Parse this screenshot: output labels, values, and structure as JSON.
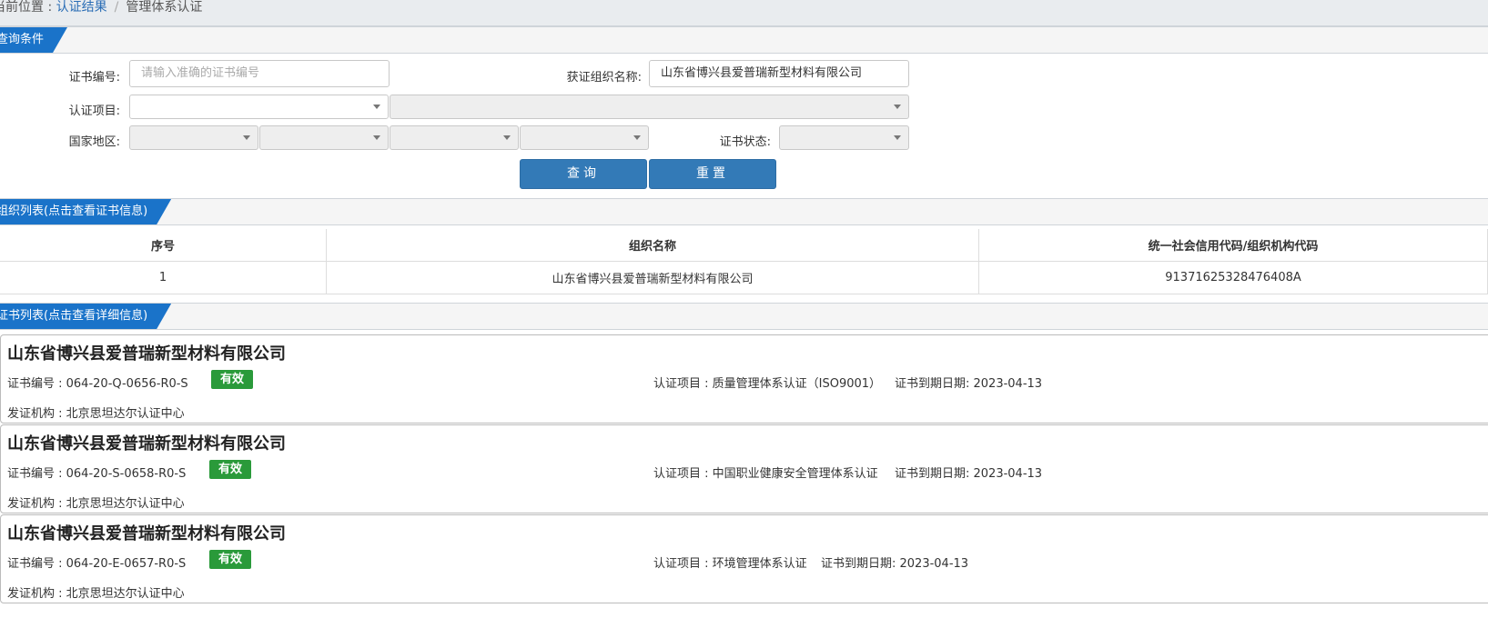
{
  "breadcrumb": {
    "prefix": "当前位置 : ",
    "link": "认证结果",
    "sep": "/",
    "current": "管理体系认证"
  },
  "query": {
    "section_title": "查询条件",
    "cert_no_label": "证书编号:",
    "cert_no_placeholder": "请输入准确的证书编号",
    "org_name_label": "获证组织名称:",
    "org_name_value": "山东省博兴县爱普瑞新型材料有限公司",
    "cert_item_label": "认证项目:",
    "region_label": "国家地区:",
    "status_label": "证书状态:",
    "search_button": "查询",
    "reset_button": "重置"
  },
  "org_list": {
    "section_title": "组织列表(点击查看证书信息)",
    "columns": [
      "序号",
      "组织名称",
      "统一社会信用代码/组织机构代码"
    ],
    "rows": [
      {
        "index": "1",
        "name": "山东省博兴县爱普瑞新型材料有限公司",
        "code": "91371625328476408A"
      }
    ]
  },
  "cert_list": {
    "section_title": "证书列表(点击查看详细信息)",
    "items": [
      {
        "title": "山东省博兴县爱普瑞新型材料有限公司",
        "cert_no": "证书编号 : 064-20-Q-0656-R0-S",
        "status": "有效",
        "item": "认证项目 : 质量管理体系认证（ISO9001）",
        "expiry": "证书到期日期: 2023-04-13",
        "issuer": "发证机构 : 北京思坦达尔认证中心"
      },
      {
        "title": "山东省博兴县爱普瑞新型材料有限公司",
        "cert_no": "证书编号 : 064-20-S-0658-R0-S",
        "status": "有效",
        "item": "认证项目 : 中国职业健康安全管理体系认证",
        "expiry": "证书到期日期: 2023-04-13",
        "issuer": "发证机构 : 北京思坦达尔认证中心"
      },
      {
        "title": "山东省博兴县爱普瑞新型材料有限公司",
        "cert_no": "证书编号 : 064-20-E-0657-R0-S",
        "status": "有效",
        "item": "认证项目 : 环境管理体系认证",
        "expiry": "证书到期日期: 2023-04-13",
        "issuer": "发证机构 : 北京思坦达尔认证中心"
      }
    ]
  },
  "colors": {
    "accent": "#1a73c9",
    "button": "#337ab7",
    "badge_valid": "#2a9a3a"
  }
}
